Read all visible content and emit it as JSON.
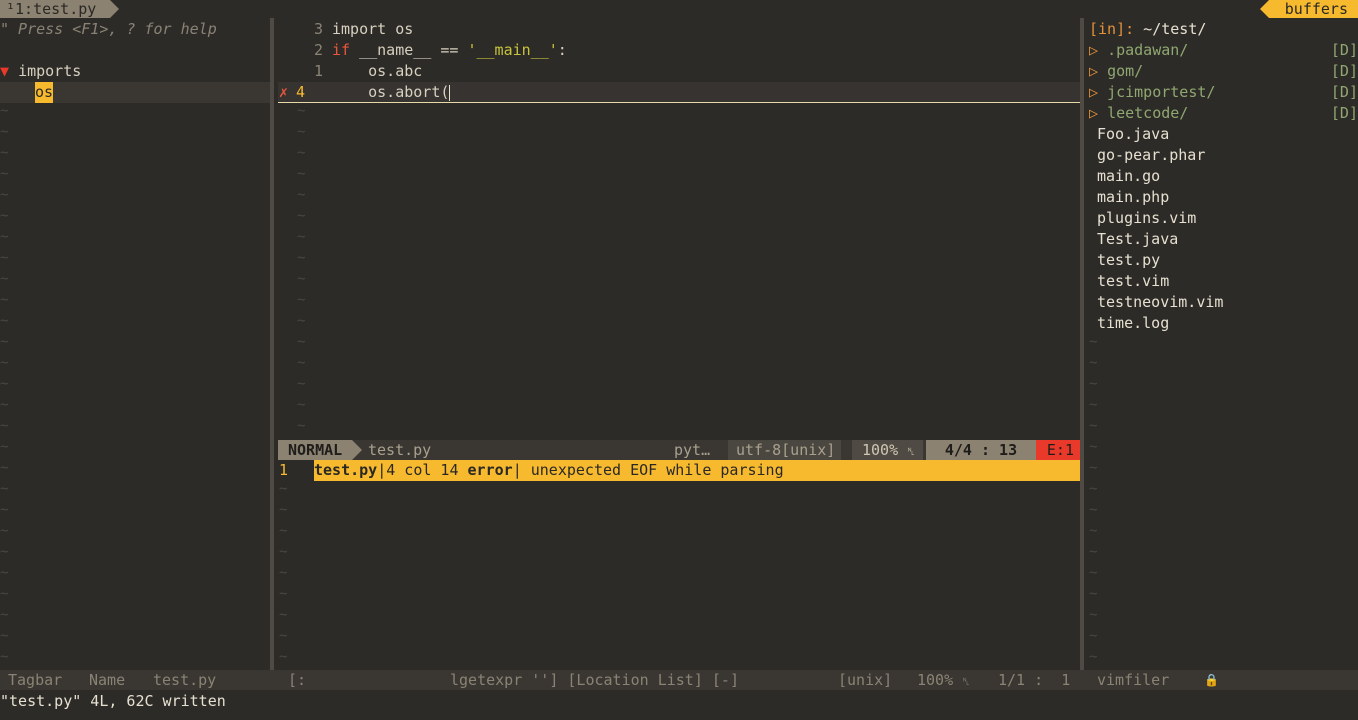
{
  "tabline": {
    "tab_label": "¹1:test.py",
    "right_label": "buffers"
  },
  "tagbar": {
    "help": "\" Press <F1>, ? for help",
    "group_marker": "▼",
    "group": "imports",
    "item": "os",
    "status_name": "Tagbar",
    "status_col": "Name",
    "status_file": "test.py"
  },
  "editor": {
    "lines": [
      {
        "num": "3",
        "tokens": [
          "import os"
        ]
      },
      {
        "num": "2",
        "kw": "if",
        "rest": " __name__ == ",
        "str": "'__main__'",
        "tail": ":"
      },
      {
        "num": "1",
        "text": "    os.abc"
      },
      {
        "num": "4",
        "sign": "✗",
        "text": "    os.abort("
      }
    ],
    "tilde": "~"
  },
  "statusline": {
    "mode": "NORMAL",
    "file": "test.py",
    "filetype": "pyt…",
    "encoding": "utf-8[unix]",
    "percent": "100%",
    "ln_icon": "␤",
    "position": "4/4 : 13",
    "errors": "E:1"
  },
  "loclist": {
    "num": "1",
    "file": "test.py",
    "sep1": "|4 col 14 ",
    "type": "error",
    "message": "| unexpected EOF while parsing"
  },
  "loclist_status": {
    "left": "[:",
    "title": "lgetexpr ''] [Location List] [-]",
    "format": "[unix]",
    "percent": "100%",
    "position": "1/1 :  1"
  },
  "vimfiler": {
    "header_prefix": "[in]:",
    "header_path": " ~/test/",
    "dirs": [
      ".padawan/",
      "gom/",
      "jcimportest/",
      "leetcode/"
    ],
    "dir_tag": "[D]",
    "files": [
      "Foo.java",
      "go-pear.phar",
      "main.go",
      "main.php",
      "plugins.vim",
      "Test.java",
      "test.py",
      "test.vim",
      "testneovim.vim",
      "time.log"
    ],
    "status_name": "vimfiler",
    "lock_icon": "🔒"
  },
  "cmdline": "\"test.py\" 4L, 62C written",
  "colors": {
    "background": "#2d2b28",
    "accent": "#f7ba2f",
    "error": "#e8392b",
    "keyword": "#e8563b",
    "string": "#c8c53a",
    "directory": "#8fa770"
  }
}
